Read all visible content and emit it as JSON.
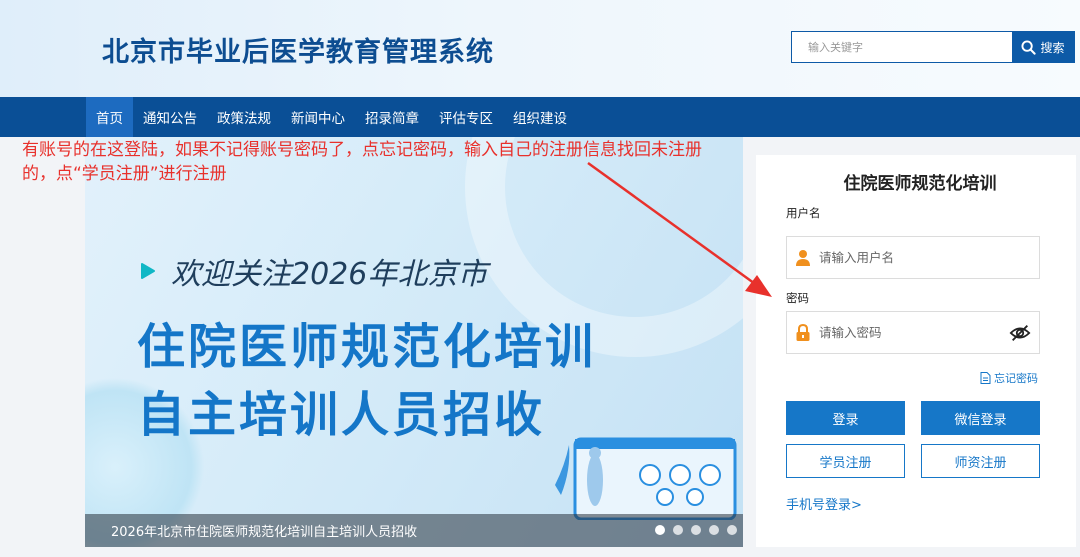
{
  "header": {
    "title": "北京市毕业后医学教育管理系统",
    "search_placeholder": "输入关键字",
    "search_button": "搜索"
  },
  "nav": {
    "items": [
      "首页",
      "通知公告",
      "政策法规",
      "新闻中心",
      "招录简章",
      "评估专区",
      "组织建设"
    ],
    "active_index": 0
  },
  "annotation": {
    "line1": "有账号的在这登陆，如果不记得账号密码了，点忘记密码，输入自己的注册信息找回未注册",
    "line2": "的，点“学员注册”进行注册"
  },
  "banner": {
    "line1": "欢迎关注2026年北京市",
    "line2": "住院医师规范化培训",
    "line3": "自主培训人员招收",
    "caption": "2026年北京市住院医师规范化培训自主培训人员招收",
    "slide_count": 5,
    "active_slide": 0
  },
  "login": {
    "title": "住院医师规范化培训",
    "username_label": "用户名",
    "username_placeholder": "请输入用户名",
    "password_label": "密码",
    "password_placeholder": "请输入密码",
    "forgot": "忘记密码",
    "login_button": "登录",
    "wechat_button": "微信登录",
    "student_register": "学员注册",
    "teacher_register": "师资注册",
    "phone_login": "手机号登录>"
  },
  "colors": {
    "brand": "#0d4d91",
    "nav_bg": "#0a4f96",
    "accent": "#1677c8",
    "annotation": "#e8312c",
    "icon_orange": "#f0901e"
  }
}
